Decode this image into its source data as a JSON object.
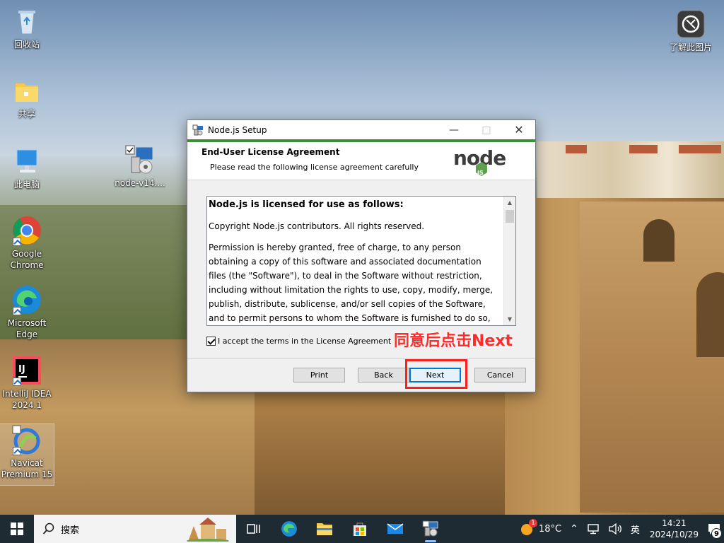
{
  "desktop": {
    "icons": [
      {
        "label": "回收站"
      },
      {
        "label": "共享"
      },
      {
        "label": "此电脑"
      },
      {
        "label": "node-v14...."
      },
      {
        "label": "Google Chrome"
      },
      {
        "label": "Microsoft Edge"
      },
      {
        "label": "IntelliJ IDEA 2024.1"
      },
      {
        "label": "Navicat Premium 15"
      },
      {
        "label": "了解此图片"
      }
    ]
  },
  "dialog": {
    "title": "Node.js Setup",
    "header_title": "End-User License Agreement",
    "header_subtitle": "Please read the following license agreement carefully",
    "logo_text": "node",
    "logo_badge": "JS",
    "license": {
      "heading": "Node.js is licensed for use as follows:",
      "paragraph1": "Copyright Node.js contributors. All rights reserved.",
      "paragraph2": "Permission is hereby granted, free of charge, to any person obtaining a copy of this software and associated documentation files (the \"Software\"), to deal in the Software without restriction, including without limitation the rights to use, copy, modify, merge, publish, distribute, sublicense, and/or sell copies of the Software, and to permit persons to whom the Software is furnished to do so, subject"
    },
    "accept_label": "I accept the terms in the License Agreement",
    "accept_checked": true,
    "buttons": {
      "print": "Print",
      "back": "Back",
      "next": "Next",
      "cancel": "Cancel"
    },
    "annotation": "同意后点击Next"
  },
  "taskbar": {
    "search_placeholder": "搜索",
    "weather_temp": "18°C",
    "weather_badge": "1",
    "ime": "英",
    "time": "14:21",
    "date": "2024/10/29",
    "notification_count": "9"
  },
  "colors": {
    "accent_green": "#3f8f3a",
    "annotation_red": "#ff2a2a",
    "taskbar_bg": "#1f2b33",
    "default_button_border": "#0078d7"
  }
}
